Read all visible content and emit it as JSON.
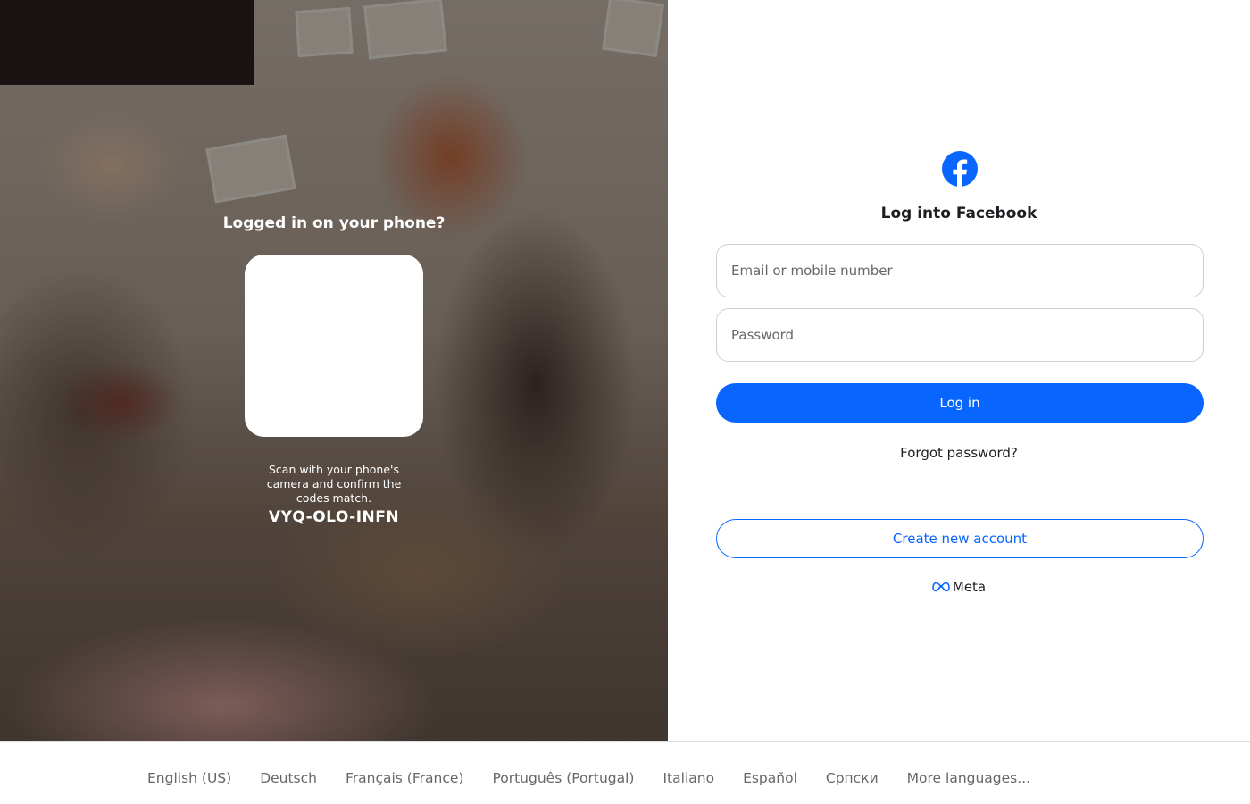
{
  "qr_login": {
    "title": "Logged in on your phone?",
    "instructions": "Scan with your phone's camera and confirm the codes match.",
    "code": "VYQ-OLO-INFN"
  },
  "login": {
    "logo_icon": "facebook-logo-icon",
    "title": "Log into Facebook",
    "email_placeholder": "Email or mobile number",
    "email_value": "",
    "password_placeholder": "Password",
    "password_value": "",
    "login_label": "Log in",
    "forgot_label": "Forgot password?",
    "create_label": "Create new account",
    "meta_label": "Meta"
  },
  "footer": {
    "languages": [
      "English (US)",
      "Deutsch",
      "Français (France)",
      "Português (Portugal)",
      "Italiano",
      "Español",
      "Српски",
      "More languages..."
    ]
  },
  "colors": {
    "brand_blue": "#0866ff",
    "text_primary": "#1c1e21",
    "text_secondary": "#65676b",
    "border": "#ccd0d5"
  }
}
